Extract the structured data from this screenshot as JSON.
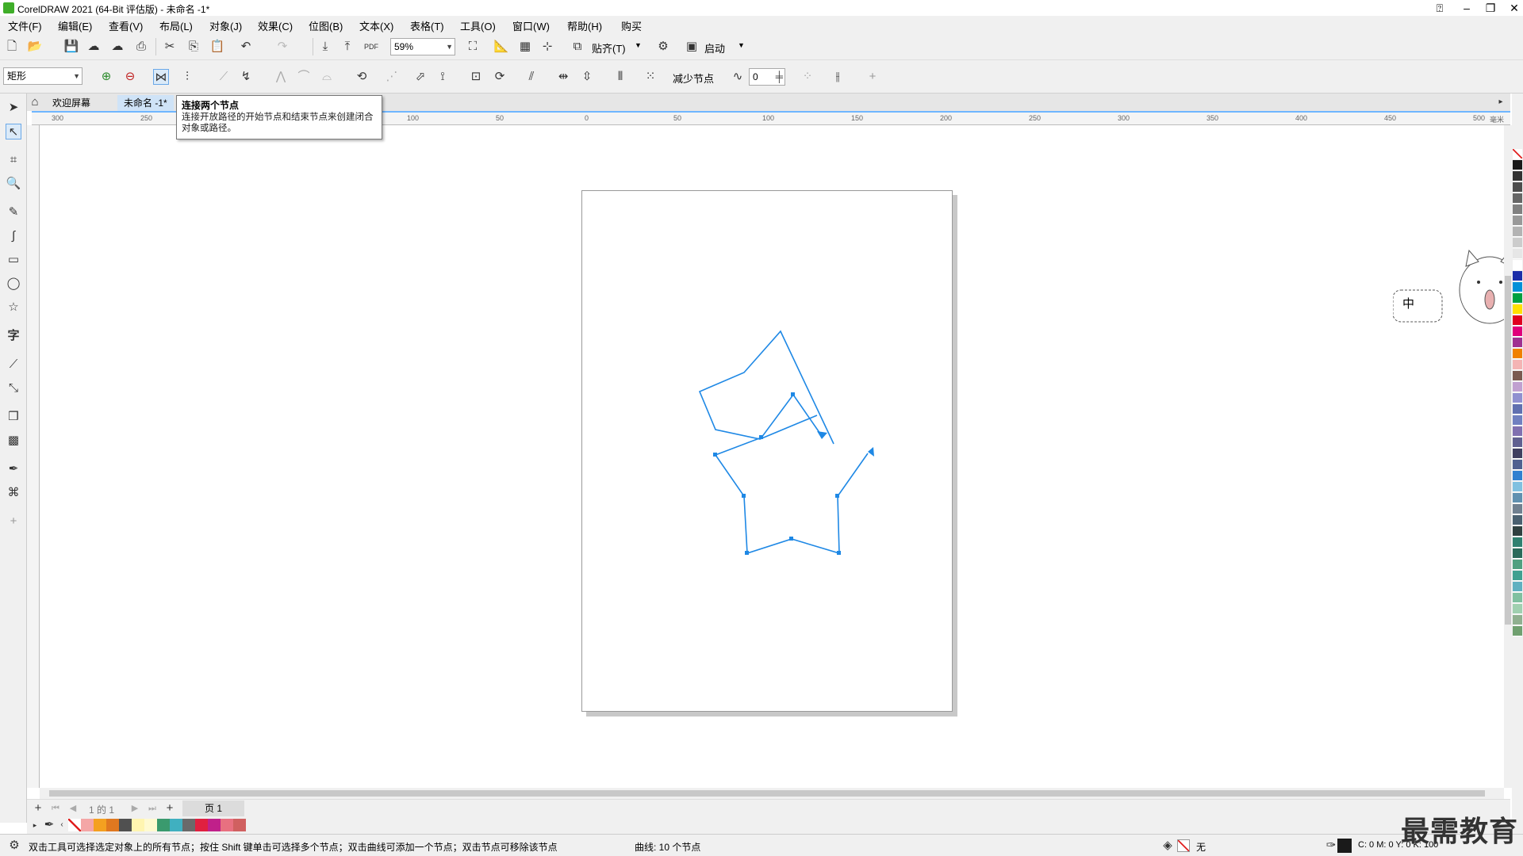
{
  "app": {
    "title": "CorelDRAW 2021 (64-Bit 评估版) - 未命名 -1*"
  },
  "menu": [
    "文件(F)",
    "编辑(E)",
    "查看(V)",
    "布局(L)",
    "对象(J)",
    "效果(C)",
    "位图(B)",
    "文本(X)",
    "表格(T)",
    "工具(O)",
    "窗口(W)",
    "帮助(H)",
    "购买"
  ],
  "toolbar": {
    "zoom_value": "59%",
    "snap_label": "贴齐(T)",
    "launch_label": "启动"
  },
  "property_bar": {
    "shape_select": "矩形",
    "reduce_nodes_label": "减少节点",
    "curve_smoothness_value": "0"
  },
  "tabs": {
    "welcome": "欢迎屏幕",
    "document": "未命名 -1*"
  },
  "tooltip": {
    "title": "连接两个节点",
    "body": "连接开放路径的开始节点和结束节点来创建闭合对象或路径。"
  },
  "ruler": {
    "units": "毫米",
    "ticks": [
      "300",
      "250",
      "200",
      "150",
      "100",
      "50",
      "0",
      "50",
      "100",
      "150",
      "200",
      "250",
      "300",
      "350",
      "400",
      "450",
      "500"
    ]
  },
  "page_nav": {
    "page_counter": "1 的 1",
    "page_tab": "页 1"
  },
  "statusbar": {
    "hint": "双击工具可选择选定对象上的所有节点；按住 Shift 键单击可选择多个节点；双击曲线可添加一个节点；双击节点可移除该节点",
    "object_info": "曲线:  10 个节点",
    "fill_label": "无",
    "color_readout": "C: 0 M: 0 Y: 0 K: 100"
  },
  "mascot": {
    "ime_label": "中"
  },
  "watermark": "最需教育",
  "colors": {
    "path_stroke": "#1e88e5",
    "ruler_accent": "#6fb6ff",
    "doc_palette": [
      "#ffffff",
      "#f4a6a6",
      "#f4a020",
      "#e07820",
      "#505050",
      "#fff5b0",
      "#fffad0",
      "#3a9a6e",
      "#40b0c0",
      "#6a6a6a",
      "#e02040",
      "#c0208a",
      "#e87080",
      "#d06060"
    ],
    "palette": [
      "#ffffff",
      "#1a1a1a",
      "#333333",
      "#4d4d4d",
      "#666666",
      "#808080",
      "#999999",
      "#b3b3b3",
      "#cccccc",
      "#e6e6e6",
      "#ffffff",
      "#1c2ea8",
      "#0090d8",
      "#00a040",
      "#ffe000",
      "#e00020",
      "#e0007a",
      "#a03090",
      "#f08000",
      "#f4b4b4",
      "#7a5a50",
      "#c0a0d0",
      "#9090d0",
      "#6070b0",
      "#7080c0",
      "#8070b0",
      "#606090",
      "#404060",
      "#506090",
      "#3080d0",
      "#80c0e0",
      "#6090b0",
      "#708090",
      "#4a6070",
      "#304040",
      "#308070",
      "#2a6a5a",
      "#50a080",
      "#40a090",
      "#60b0c0",
      "#80c0a0",
      "#a0d0b0",
      "#90b090",
      "#70a070"
    ]
  }
}
